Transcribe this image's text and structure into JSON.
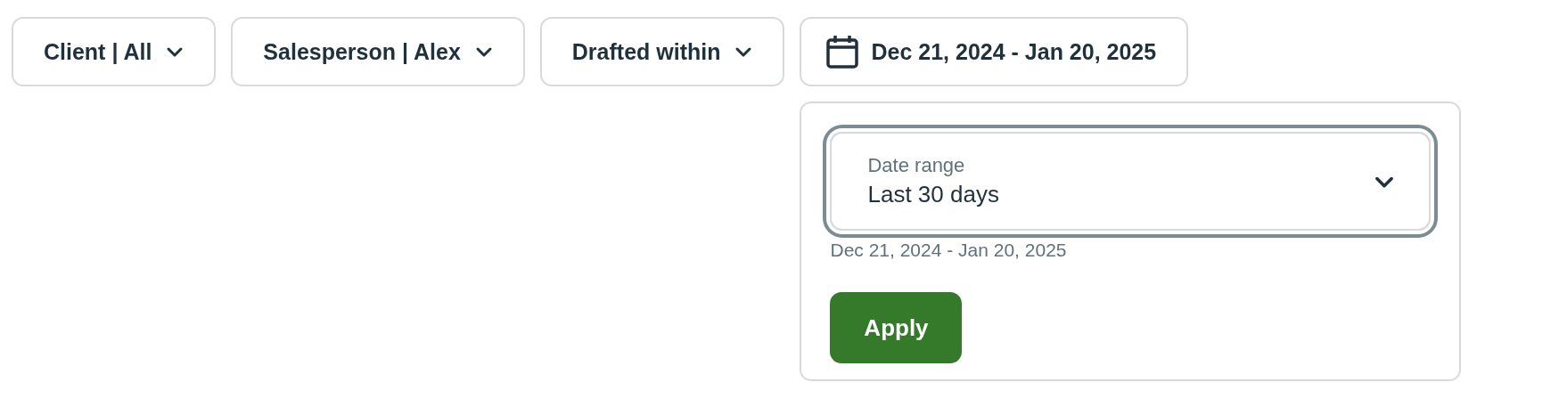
{
  "filters": [
    {
      "kind": "dropdown",
      "label": "Client | All"
    },
    {
      "kind": "dropdown",
      "label": "Salesperson | Alex"
    },
    {
      "kind": "dropdown",
      "label": "Drafted within"
    },
    {
      "kind": "date",
      "label": "Dec 21, 2024 - Jan 20, 2025"
    }
  ],
  "date_popover": {
    "select": {
      "label": "Date range",
      "value": "Last 30 days",
      "focused": true
    },
    "summary": "Dec 21, 2024 - Jan 20, 2025",
    "apply_button": "Apply"
  }
}
